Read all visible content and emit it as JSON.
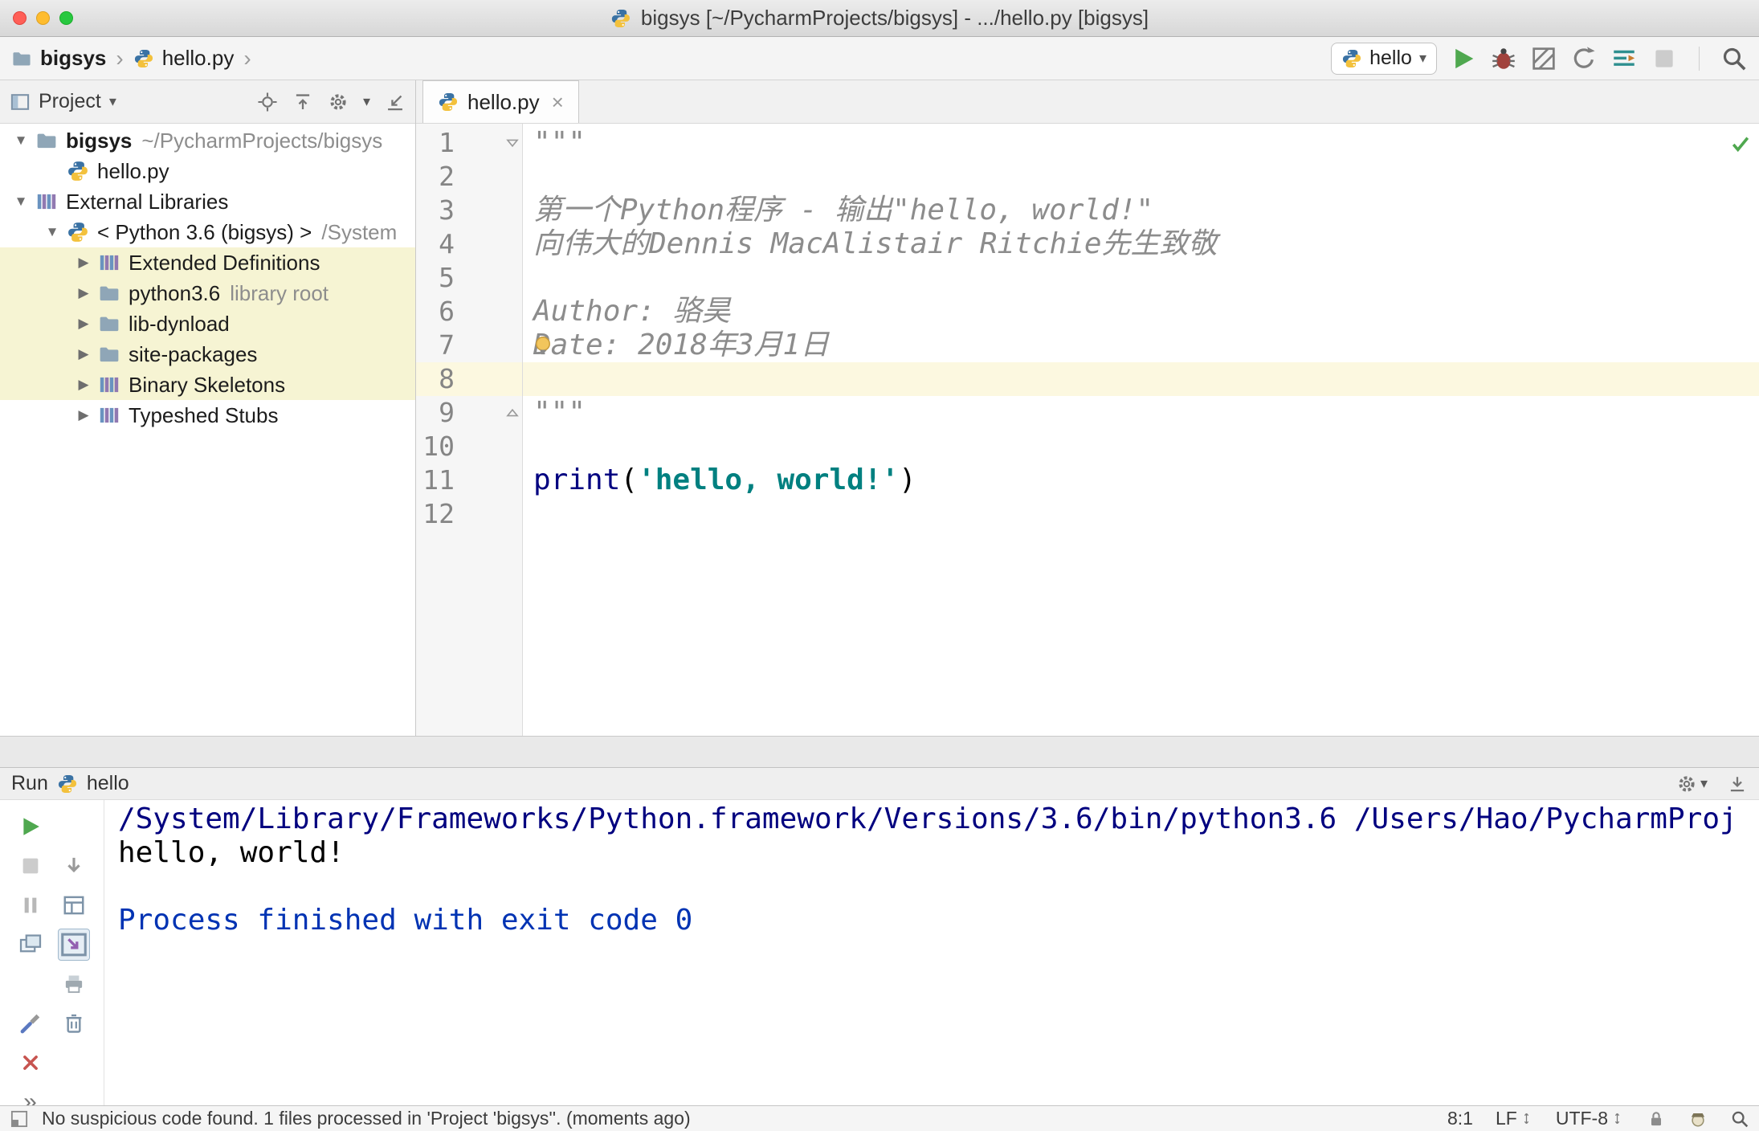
{
  "window": {
    "title": "bigsys [~/PycharmProjects/bigsys] - .../hello.py [bigsys]"
  },
  "navbar": {
    "crumbs": [
      {
        "label": "bigsys",
        "icon": "folder"
      },
      {
        "label": "hello.py",
        "icon": "python"
      }
    ],
    "run_config": {
      "label": "hello",
      "icon": "python"
    }
  },
  "project": {
    "title": "Project",
    "tree": [
      {
        "level": 0,
        "arrow": "expanded",
        "icon": "folder",
        "label": "bigsys",
        "bold": true,
        "suffix": "~/PycharmProjects/bigsys"
      },
      {
        "level": 1,
        "arrow": "none",
        "icon": "python",
        "label": "hello.py"
      },
      {
        "level": 0,
        "arrow": "expanded",
        "icon": "library",
        "label": "External Libraries"
      },
      {
        "level": 1,
        "arrow": "expanded",
        "icon": "python",
        "label": "< Python 3.6 (bigsys) >",
        "suffix": "/System"
      },
      {
        "level": 2,
        "arrow": "collapsed",
        "icon": "library",
        "label": "Extended Definitions",
        "highlight": true
      },
      {
        "level": 2,
        "arrow": "collapsed",
        "icon": "folder",
        "label": "python3.6",
        "suffix": "library root",
        "highlight": true
      },
      {
        "level": 2,
        "arrow": "collapsed",
        "icon": "folder",
        "label": "lib-dynload",
        "highlight": true
      },
      {
        "level": 2,
        "arrow": "collapsed",
        "icon": "folder",
        "label": "site-packages",
        "highlight": true
      },
      {
        "level": 2,
        "arrow": "collapsed",
        "icon": "library",
        "label": "Binary Skeletons",
        "highlight": true
      },
      {
        "level": 2,
        "arrow": "collapsed",
        "icon": "library",
        "label": "Typeshed Stubs"
      }
    ]
  },
  "editor": {
    "tab": {
      "label": "hello.py",
      "icon": "python"
    },
    "lines": [
      {
        "n": 1,
        "fold": "down",
        "segments": [
          {
            "text": "\"\"\"",
            "style": "doc"
          }
        ]
      },
      {
        "n": 2,
        "segments": []
      },
      {
        "n": 3,
        "segments": [
          {
            "text": "第一个Python程序 - 输出\"hello, world!\"",
            "style": "doc"
          }
        ]
      },
      {
        "n": 4,
        "segments": [
          {
            "text": "向伟大的Dennis MacAlistair Ritchie先生致敬",
            "style": "doc"
          }
        ]
      },
      {
        "n": 5,
        "segments": []
      },
      {
        "n": 6,
        "segments": [
          {
            "text": "Author: 骆昊",
            "style": "doc"
          }
        ]
      },
      {
        "n": 7,
        "bulb": true,
        "segments": [
          {
            "text": "Date: 2018年3月1日",
            "style": "doc"
          }
        ]
      },
      {
        "n": 8,
        "current": true,
        "segments": []
      },
      {
        "n": 9,
        "fold": "up",
        "segments": [
          {
            "text": "\"\"\"",
            "style": "doc"
          }
        ]
      },
      {
        "n": 10,
        "segments": []
      },
      {
        "n": 11,
        "segments": [
          {
            "text": "print",
            "style": "func"
          },
          {
            "text": "(",
            "style": "plain"
          },
          {
            "text": "'hello, world!'",
            "style": "str"
          },
          {
            "text": ")",
            "style": "plain"
          }
        ]
      },
      {
        "n": 12,
        "segments": []
      }
    ]
  },
  "run": {
    "title": "Run",
    "config": {
      "label": "hello",
      "icon": "python"
    },
    "console": [
      {
        "text": "/System/Library/Frameworks/Python.framework/Versions/3.6/bin/python3.6 /Users/Hao/PycharmProj",
        "style": "cmd"
      },
      {
        "text": "hello, world!",
        "style": "out"
      },
      {
        "text": "",
        "style": "out"
      },
      {
        "text": "Process finished with exit code 0",
        "style": "info"
      }
    ]
  },
  "statusbar": {
    "message": "No suspicious code found. 1 files processed in 'Project 'bigsys''. (moments ago)",
    "caret": "8:1",
    "line_sep": "LF",
    "encoding": "UTF-8",
    "icons": [
      "lock",
      "hector",
      "search"
    ]
  },
  "colors": {
    "accent_green": "#4fa84f",
    "string": "#008080",
    "keyword": "#000080",
    "doc_comment": "#8c8c8c",
    "console_cmd": "#00007f",
    "console_info": "#0033b3",
    "tree_highlight": "#f6f4d3",
    "current_line": "#fcf8e0"
  }
}
